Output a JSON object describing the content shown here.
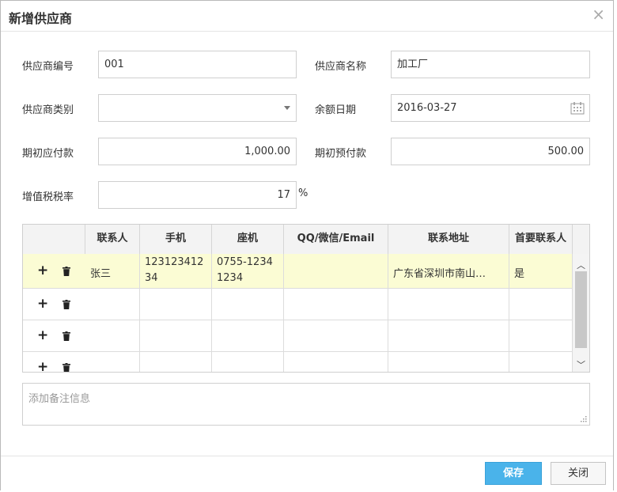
{
  "dialog": {
    "title": "新增供应商"
  },
  "form": {
    "supplier_code": {
      "label": "供应商编号",
      "value": "001"
    },
    "supplier_name": {
      "label": "供应商名称",
      "value": "加工厂"
    },
    "supplier_type": {
      "label": "供应商类别",
      "value": ""
    },
    "balance_date": {
      "label": "余额日期",
      "value": "2016-03-27"
    },
    "initial_payable": {
      "label": "期初应付款",
      "value": "1,000.00"
    },
    "initial_prepaid": {
      "label": "期初预付款",
      "value": "500.00"
    },
    "vat_rate": {
      "label": "增值税税率",
      "value": "17",
      "unit": "%"
    }
  },
  "contacts": {
    "columns": [
      "联系人",
      "手机",
      "座机",
      "QQ/微信/Email",
      "联系地址",
      "首要联系人"
    ],
    "rows": [
      {
        "name": "张三",
        "mobile_l1": "123123412",
        "mobile_l2": "34",
        "phone_l1": "0755-1234",
        "phone_l2": "1234",
        "im": "",
        "address": "广东省深圳市南山…",
        "primary": "是"
      },
      {
        "name": "",
        "mobile_l1": "",
        "mobile_l2": "",
        "phone_l1": "",
        "phone_l2": "",
        "im": "",
        "address": "",
        "primary": ""
      },
      {
        "name": "",
        "mobile_l1": "",
        "mobile_l2": "",
        "phone_l1": "",
        "phone_l2": "",
        "im": "",
        "address": "",
        "primary": ""
      },
      {
        "name": "",
        "mobile_l1": "",
        "mobile_l2": "",
        "phone_l1": "",
        "phone_l2": "",
        "im": "",
        "address": "",
        "primary": ""
      }
    ],
    "add_symbol": "+"
  },
  "remark": {
    "placeholder": "添加备注信息"
  },
  "buttons": {
    "save": "保存",
    "close": "关闭",
    "close_x": "×"
  },
  "icons": {
    "close": "close-icon",
    "dropdown": "chevron-down-icon",
    "calendar": "calendar-icon",
    "add": "plus-icon",
    "delete": "trash-icon"
  },
  "colors": {
    "primary_button": "#4ab3ea",
    "selected_row": "#fbfcd4"
  }
}
